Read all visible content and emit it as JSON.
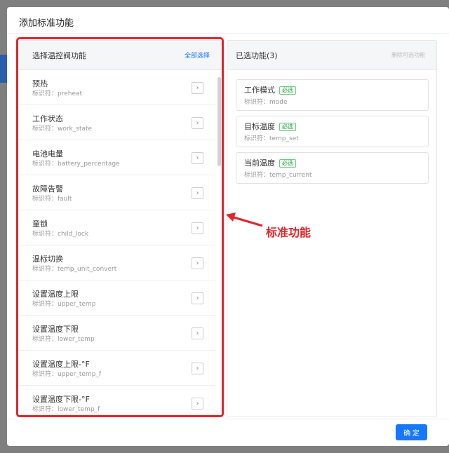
{
  "dialog": {
    "title": "添加标准功能",
    "ok_label": "确 定"
  },
  "left_panel": {
    "title": "选择温控阀功能",
    "select_all": "全部选择",
    "items": [
      {
        "name": "预热",
        "id_label": "标识符：preheat"
      },
      {
        "name": "工作状态",
        "id_label": "标识符：work_state"
      },
      {
        "name": "电池电量",
        "id_label": "标识符：battery_percentage"
      },
      {
        "name": "故障告警",
        "id_label": "标识符：fault"
      },
      {
        "name": "童锁",
        "id_label": "标识符：child_lock"
      },
      {
        "name": "温标切换",
        "id_label": "标识符：temp_unit_convert"
      },
      {
        "name": "设置温度上限",
        "id_label": "标识符：upper_temp"
      },
      {
        "name": "设置温度下限",
        "id_label": "标识符：lower_temp"
      },
      {
        "name": "设置温度上限-°F",
        "id_label": "标识符：upper_temp_f"
      },
      {
        "name": "设置温度下限-°F",
        "id_label": "标识符：lower_temp_f"
      }
    ],
    "arrow_glyph": "›"
  },
  "right_panel": {
    "title": "已选功能(3)",
    "remove_optional": "删除可选功能",
    "items": [
      {
        "name": "工作模式",
        "tag": "必选",
        "id_label": "标识符：mode"
      },
      {
        "name": "目标温度",
        "tag": "必选",
        "id_label": "标识符：temp_set"
      },
      {
        "name": "当前温度",
        "tag": "必选",
        "id_label": "标识符：temp_current"
      }
    ]
  },
  "annotation": {
    "text": "标准功能"
  },
  "colors": {
    "accent": "#1677ff",
    "annotation_red": "#e0262b",
    "required_green": "#2fa24a"
  }
}
